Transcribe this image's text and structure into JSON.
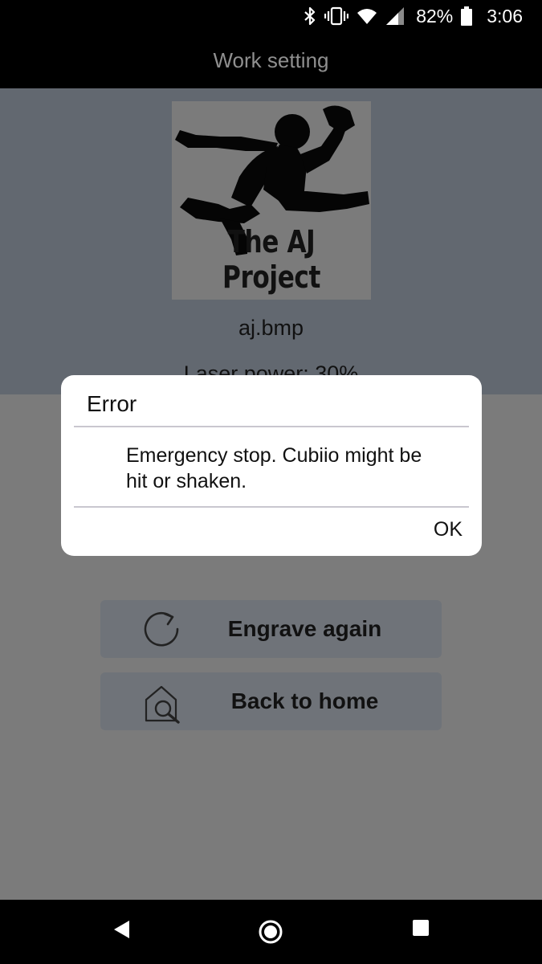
{
  "status_bar": {
    "battery_percent": "82%",
    "time": "3:06",
    "icons": [
      "bluetooth-icon",
      "vibrate-icon",
      "wifi-icon",
      "cellular-signal-icon",
      "battery-icon"
    ]
  },
  "app_bar": {
    "title": "Work setting"
  },
  "preview": {
    "image_text": "The AJ Project",
    "file_name": "aj.bmp",
    "laser_power": "Laser power: 30%"
  },
  "actions": {
    "engrave_again": {
      "label": "Engrave again",
      "icon": "refresh-icon"
    },
    "back_to_home": {
      "label": "Back to home",
      "icon": "home-search-icon"
    }
  },
  "dialog": {
    "title": "Error",
    "message": "Emergency stop. Cubiio might be hit or shaken.",
    "ok_label": "OK"
  },
  "nav_bar": {
    "icons": [
      "back-icon",
      "home-icon",
      "recents-icon"
    ]
  },
  "colors": {
    "dim_background": "#7b7b7b",
    "preview_panel": "#626870",
    "button_background": "#6f7379",
    "dialog_background": "#ffffff",
    "system_bars": "#000000"
  }
}
